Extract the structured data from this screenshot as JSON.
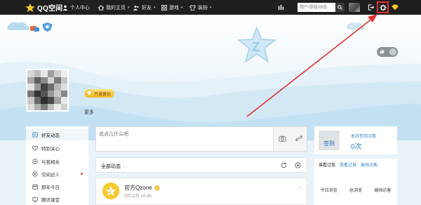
{
  "topbar": {
    "logo_text": "QQ空间",
    "nav": [
      {
        "label": "个人中心",
        "icon": "person-icon"
      },
      {
        "label": "我的主页",
        "icon": "home-icon",
        "caret": "▾"
      },
      {
        "label": "好友",
        "icon": "friends-icon",
        "caret": "▾"
      },
      {
        "label": "游戏",
        "icon": "grid-icon",
        "caret": "▾"
      },
      {
        "label": "装扮",
        "icon": "shirt-icon",
        "caret": "▾"
      }
    ],
    "search_placeholder": "用户/游戏/动态",
    "icons": [
      "bars-icon",
      "search-icon",
      "avatar",
      "logout-icon",
      "gear-icon",
      "diamond-icon"
    ]
  },
  "banner": {
    "vip_label": "开通黄钻",
    "more_label": "更多",
    "toggle_icon": "thumbs-up-icon"
  },
  "left_nav": {
    "items": [
      {
        "label": "好友动态",
        "icon": "feed-icon",
        "active": true
      },
      {
        "label": "特别关心",
        "icon": "heart-icon"
      },
      {
        "label": "与我相关",
        "icon": "bell-icon"
      },
      {
        "label": "空间达人",
        "icon": "talent-icon",
        "dot": true
      },
      {
        "label": "那年今日",
        "icon": "calendar-icon"
      },
      {
        "label": "腾讯课堂",
        "icon": "class-icon"
      }
    ]
  },
  "composer": {
    "placeholder": "说点儿什么吧",
    "icons": [
      "camera-icon",
      "link-icon"
    ]
  },
  "filter": {
    "label": "全部动态",
    "caret": "⌄",
    "icons": [
      "refresh-icon",
      "settings-circle-icon"
    ]
  },
  "feed": {
    "name": "官方Qzone",
    "date": "2月10日 16:36",
    "caret": "⌄"
  },
  "checkin": {
    "button": "签到",
    "label": "本月签到次数",
    "count": "0次"
  },
  "visitors": {
    "tabs": [
      "谁看过我",
      "我看过谁",
      "被挡访客"
    ],
    "stats": [
      "今日浏览",
      "总浏览",
      "被挡访客"
    ]
  },
  "colors": {
    "topbar": "#1f1f1f",
    "accent_blue": "#3a83c6",
    "annotation_red": "#e23030",
    "gold": "#f2b81f"
  }
}
